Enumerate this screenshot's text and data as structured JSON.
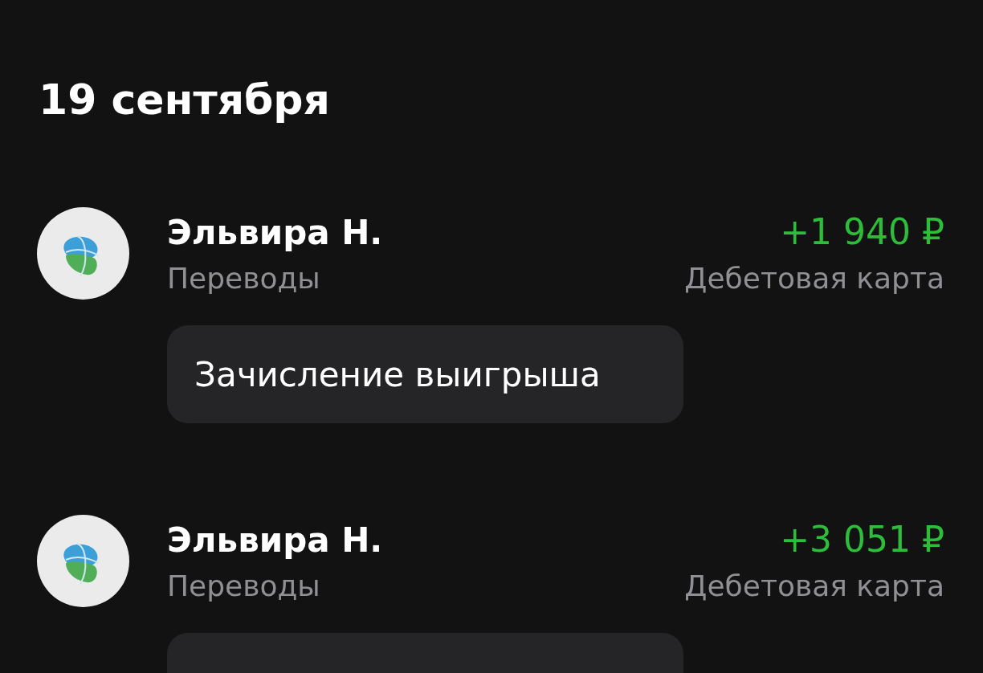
{
  "date_heading": "19 сентября",
  "transactions": [
    {
      "name": "Эльвира Н.",
      "category": "Переводы",
      "amount": "+1 940 ₽",
      "account": "Дебетовая карта",
      "note": "Зачисление выигрыша"
    },
    {
      "name": "Эльвира Н.",
      "category": "Переводы",
      "amount": "+3 051 ₽",
      "account": "Дебетовая карта"
    }
  ]
}
